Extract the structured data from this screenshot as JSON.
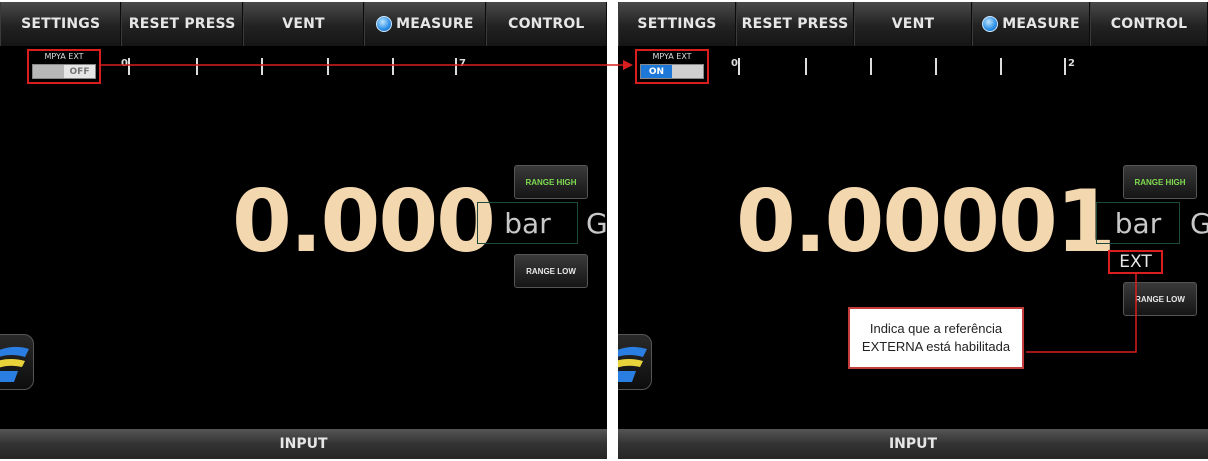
{
  "menu": {
    "settings": "SETTINGS",
    "reset_press": "RESET PRESS",
    "vent": "VENT",
    "measure": "MEASURE",
    "control": "CONTROL"
  },
  "left_panel": {
    "toggle_label": "MPYA EXT",
    "toggle_state": "OFF",
    "scale_start": "0",
    "scale_end": "7",
    "reading": "0.000",
    "unit": "bar",
    "unit_suffix": "G",
    "range_high": "RANGE HIGH",
    "range_low": "RANGE LOW",
    "input": "INPUT"
  },
  "right_panel": {
    "toggle_label": "MPYA EXT",
    "toggle_state": "ON",
    "scale_start": "0",
    "scale_end": "2",
    "reading": "0.00001",
    "unit": "bar",
    "unit_suffix": "G",
    "ext": "EXT",
    "range_high": "RANGE HIGH",
    "range_low": "RANGE LOW",
    "input": "INPUT",
    "callout": "Indica que a referência EXTERNA está habilitada"
  },
  "colors": {
    "reading": "#f3d7ae",
    "annotation_red": "#d81e1e",
    "toggle_on": "#1e78d8",
    "range_high_text": "#7edb4f"
  },
  "icons": [
    "measure-indicator-icon",
    "brand-logo-icon"
  ]
}
